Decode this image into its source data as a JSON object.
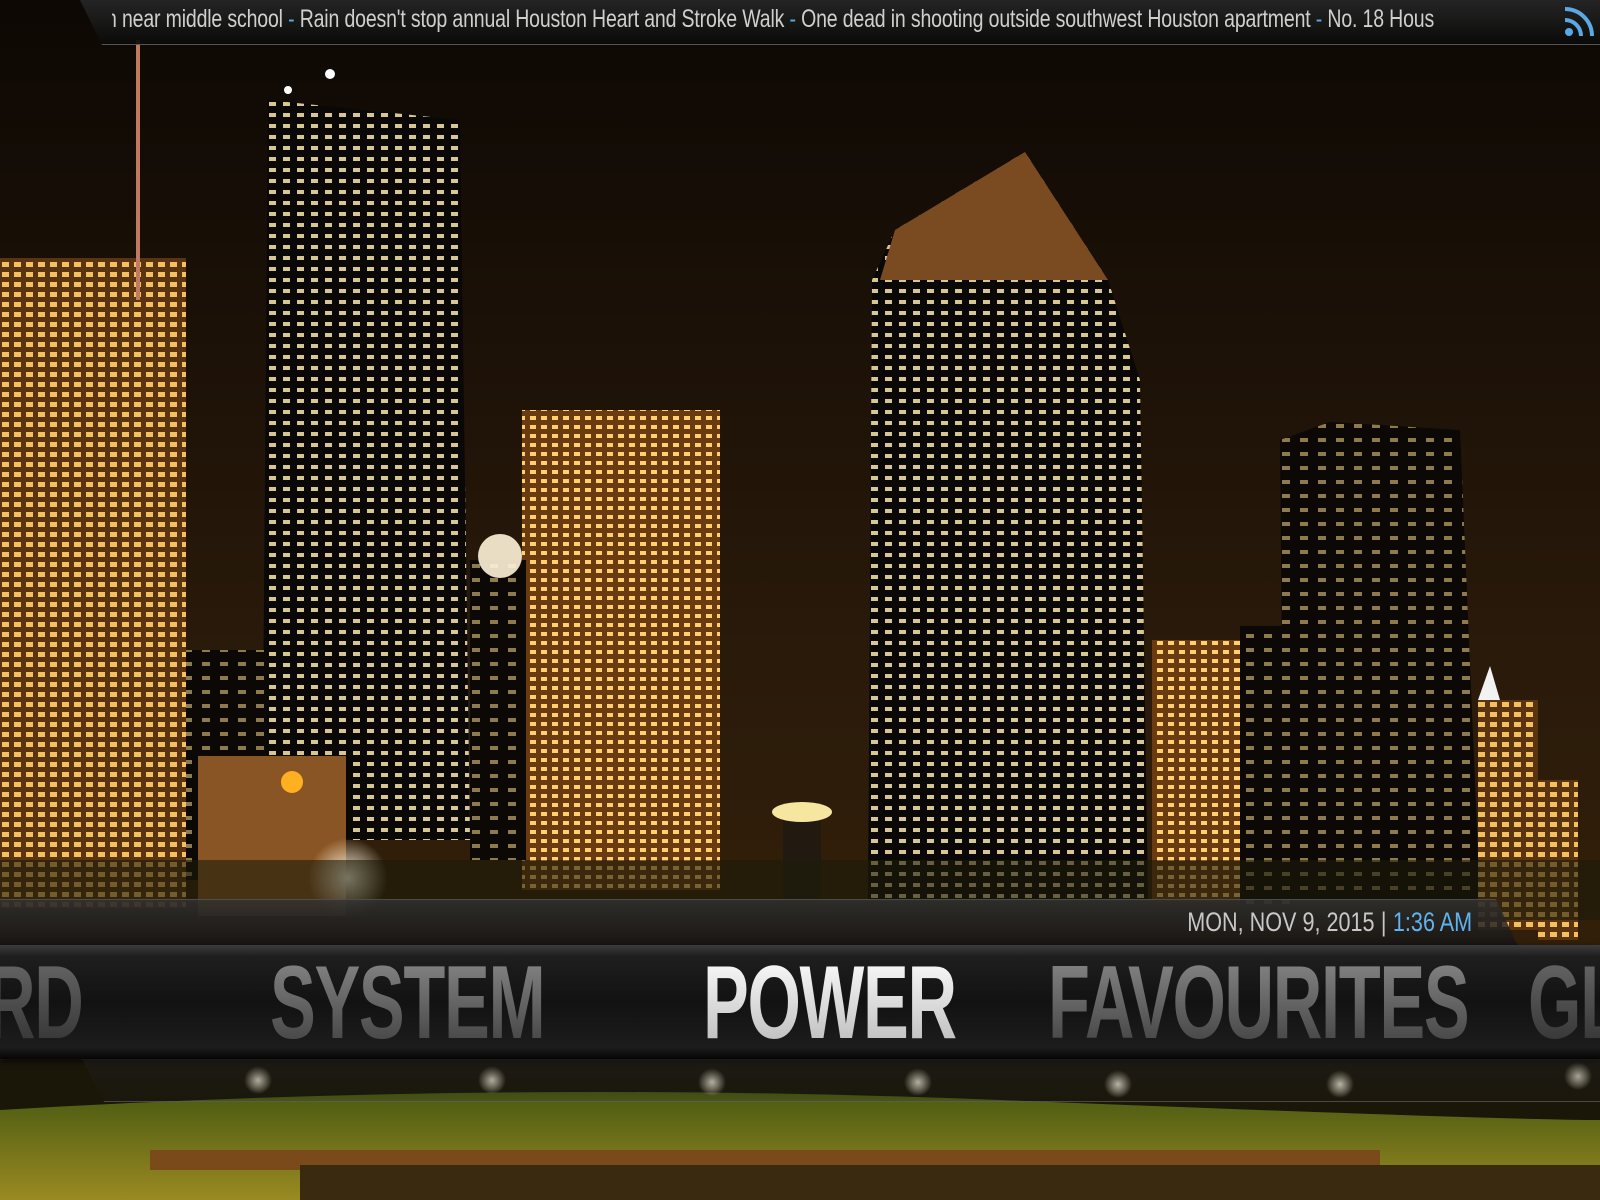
{
  "ticker": {
    "headlines": [
      "n near middle school",
      "Rain doesn't stop annual Houston Heart and Stroke Walk",
      "One dead in shooting outside southwest Houston apartment",
      "No. 18 Hous"
    ],
    "separator": " - "
  },
  "clock": {
    "date": "MON, NOV 9, 2015",
    "separator": "|",
    "time": "1:36 AM"
  },
  "menu": {
    "items": [
      {
        "label": "RD",
        "state": "partial"
      },
      {
        "label": "SYSTEM",
        "state": "inactive"
      },
      {
        "label": "POWER",
        "state": "active"
      },
      {
        "label": "FAVOURITES",
        "state": "inactive"
      },
      {
        "label": "GL",
        "state": "partial"
      }
    ]
  },
  "colors": {
    "accent": "#5fb4ef",
    "rss": "#5aa9e6"
  },
  "icons": {
    "feed": "rss-icon"
  }
}
